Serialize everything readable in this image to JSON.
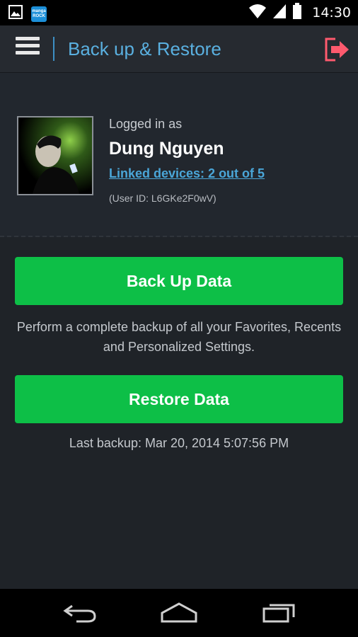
{
  "status_bar": {
    "time": "14:30",
    "notification_icons": [
      "image-icon",
      "manga-rock-icon"
    ],
    "manga_rock_text_top": "manga",
    "manga_rock_text_bottom": "ROCK",
    "system_icons": [
      "wifi-icon",
      "signal-icon",
      "battery-icon"
    ]
  },
  "app_bar": {
    "title": "Back up & Restore",
    "menu_icon": "hamburger-menu-icon",
    "logout_icon": "logout-icon",
    "accent_color": "#5ab0e0",
    "logout_color": "#ff5a6e"
  },
  "profile": {
    "logged_in_label": "Logged in as",
    "user_name": "Dung Nguyen",
    "linked_devices": "Linked devices: 2 out of 5",
    "user_id": "(User ID: L6GKe2F0wV)"
  },
  "actions": {
    "backup_label": "Back Up Data",
    "backup_description": "Perform a complete backup of all your Favorites, Recents and Personalized Settings.",
    "restore_label": "Restore Data",
    "last_backup": "Last backup: Mar 20, 2014 5:07:56 PM",
    "button_color": "#0dbf47"
  },
  "nav_bar": {
    "icons": [
      "back-icon",
      "home-icon",
      "recents-icon"
    ]
  }
}
